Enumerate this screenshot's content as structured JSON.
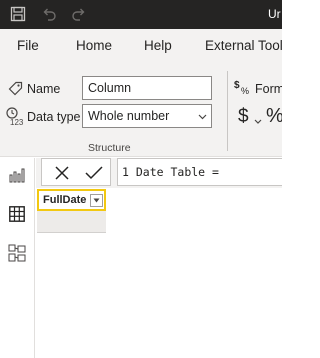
{
  "titlebar": {
    "title": "Ur",
    "icons": [
      "save-icon",
      "undo-icon",
      "redo-icon"
    ]
  },
  "menu": {
    "items": [
      {
        "label": "File"
      },
      {
        "label": "Home"
      },
      {
        "label": "Help"
      },
      {
        "label": "External Tool"
      }
    ]
  },
  "ribbon": {
    "name_label": "Name",
    "name_value": "Column",
    "datatype_label": "Data type",
    "datatype_value": "Whole number",
    "group_label": "Structure",
    "format_label": "Form",
    "currency_symbol": "$",
    "percent_symbol": "%"
  },
  "formula": {
    "line_number": "1",
    "text": "Date Table ="
  },
  "table": {
    "column_header": "FullDate"
  },
  "colors": {
    "titlebar": "#252423",
    "ribbon_bg": "#f3f2f1",
    "selected_column_border": "#f2c811"
  }
}
